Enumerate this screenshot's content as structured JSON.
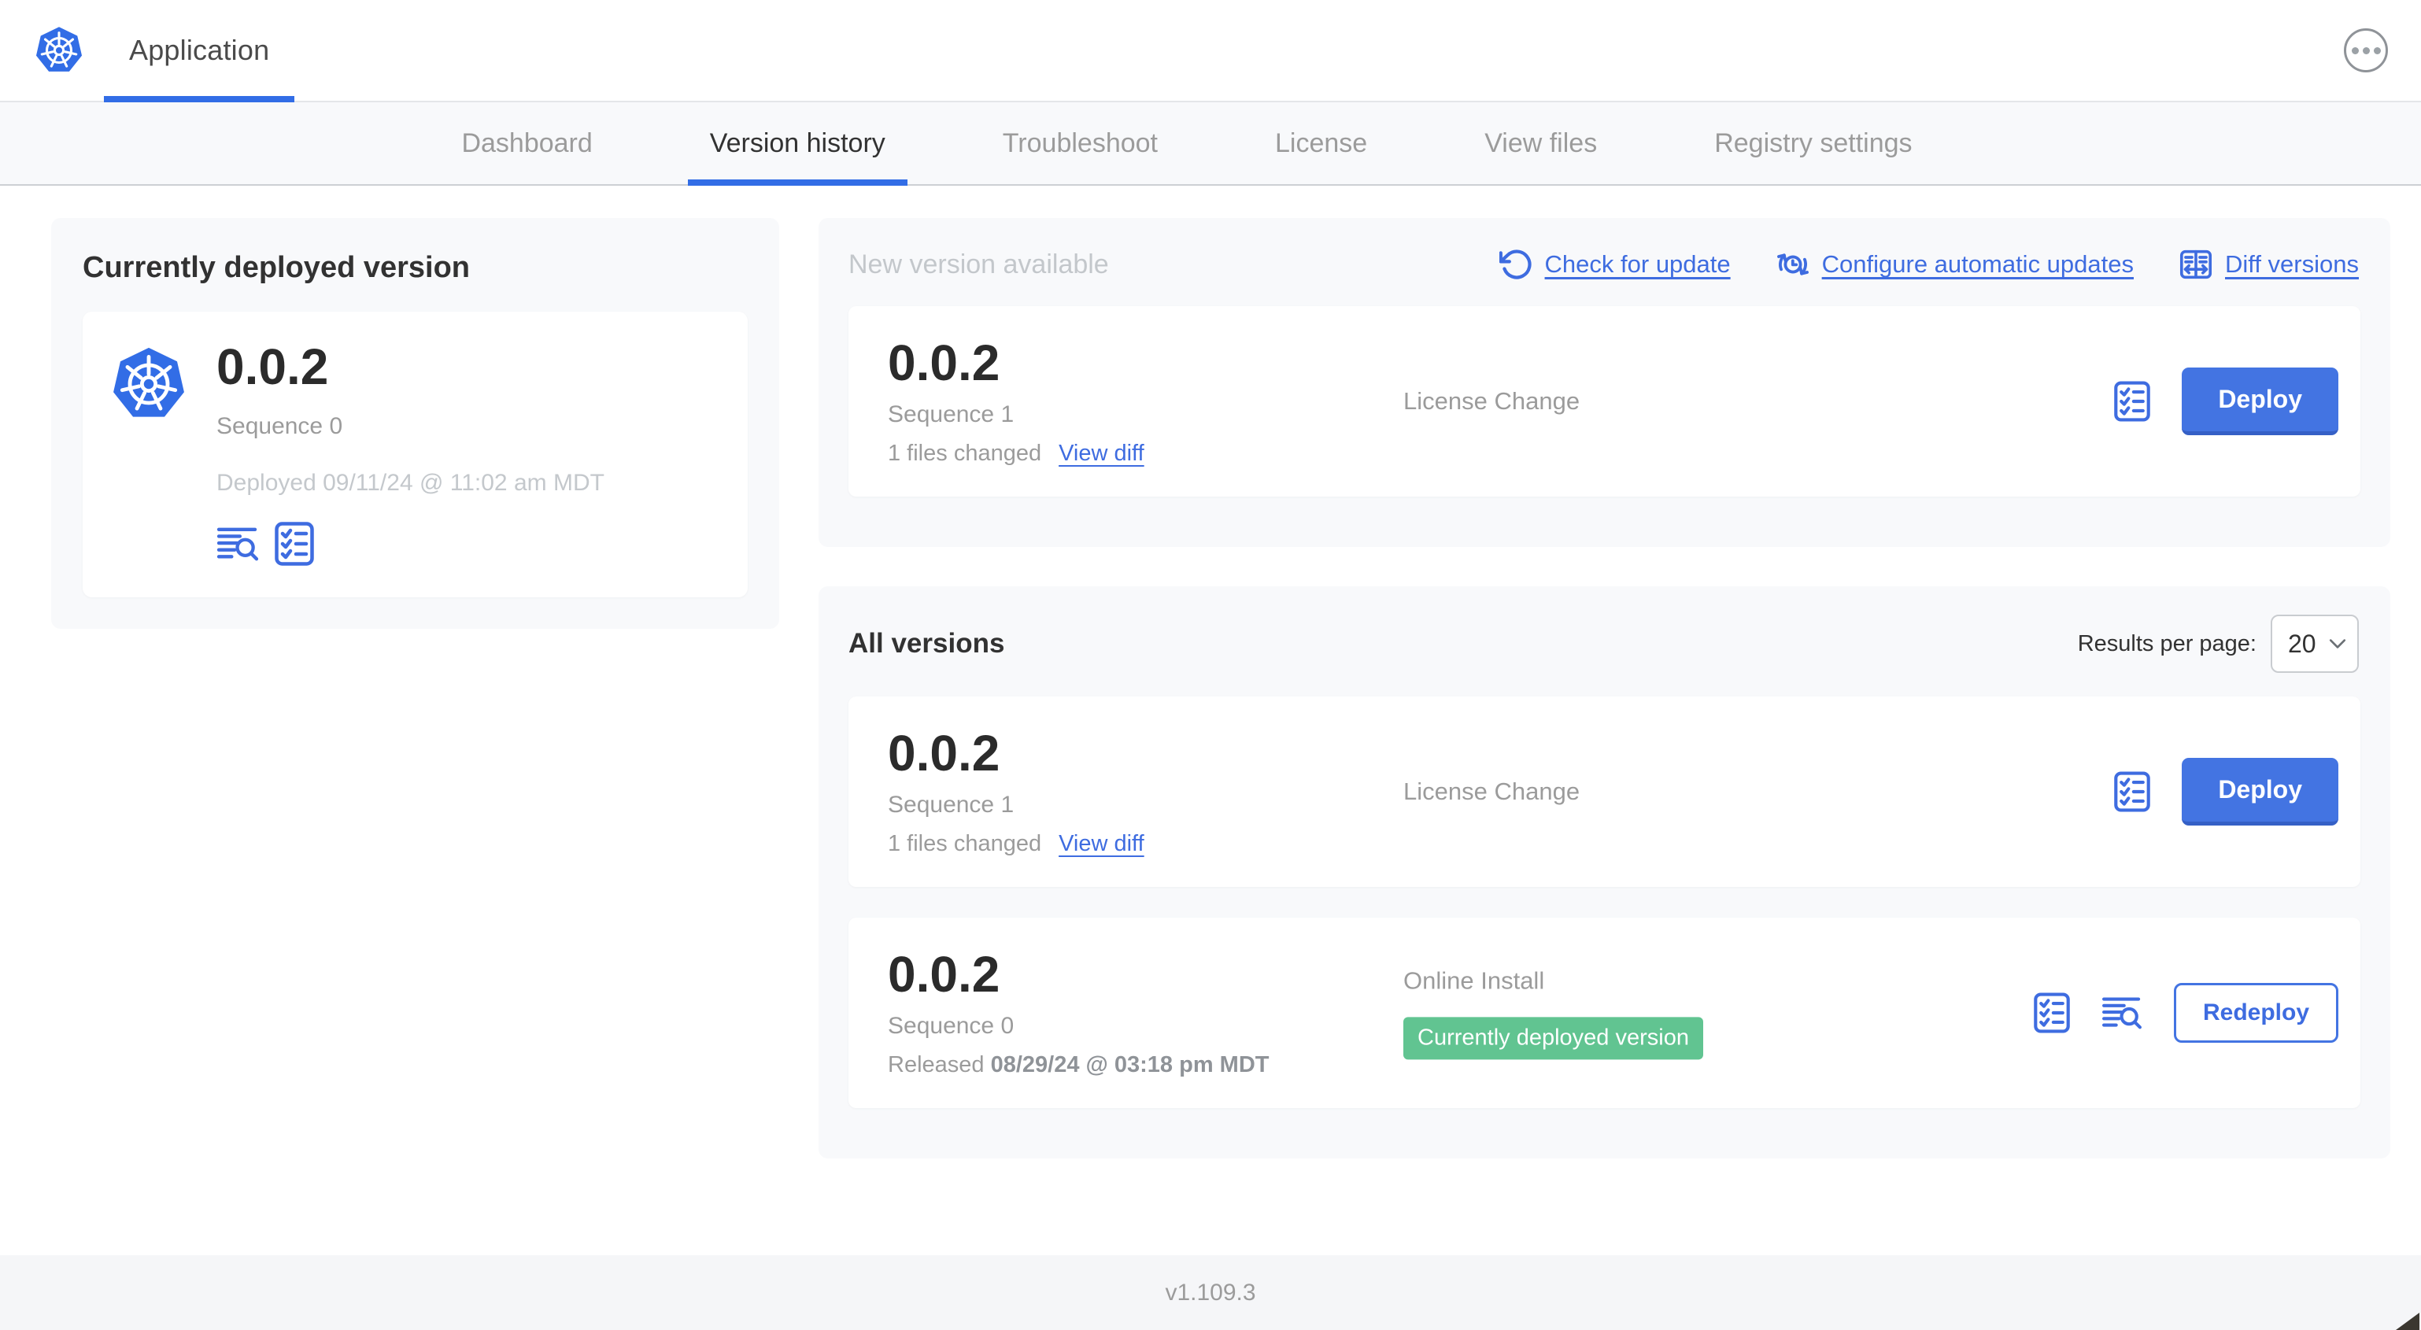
{
  "header": {
    "app_name": "Application"
  },
  "nav": {
    "tabs": [
      "Dashboard",
      "Version history",
      "Troubleshoot",
      "License",
      "View files",
      "Registry settings"
    ],
    "active_tab": "Version history"
  },
  "current": {
    "title": "Currently deployed version",
    "version": "0.0.2",
    "sequence": "Sequence 0",
    "deployed": "Deployed 09/11/24 @ 11:02 am MDT"
  },
  "new_version": {
    "title": "New version available",
    "check_link": "Check for update",
    "configure_link": "Configure automatic updates",
    "diff_link": "Diff versions",
    "row": {
      "version": "0.0.2",
      "sequence": "Sequence 1",
      "files_changed": "1 files changed",
      "view_diff": "View diff",
      "source": "License Change",
      "action_label": "Deploy"
    }
  },
  "all_versions": {
    "title": "All versions",
    "results_per_page_label": "Results per page:",
    "results_per_page_value": "20",
    "rows": [
      {
        "version": "0.0.2",
        "sequence": "Sequence 1",
        "files_changed": "1 files changed",
        "view_diff": "View diff",
        "source": "License Change",
        "action_label": "Deploy"
      },
      {
        "version": "0.0.2",
        "sequence": "Sequence 0",
        "released_prefix": "Released ",
        "released_date": "08/29/24 @ 03:18 pm MDT",
        "source": "Online Install",
        "badge": "Currently deployed version",
        "action_label": "Redeploy"
      }
    ]
  },
  "footer": {
    "version": "v1.109.3"
  },
  "colors": {
    "accent_blue": "#3e6ce0",
    "button_blue": "#4374e2",
    "k8s_blue": "#326de6",
    "badge_green": "#61c491",
    "panel_gray": "#f8f9fb"
  }
}
